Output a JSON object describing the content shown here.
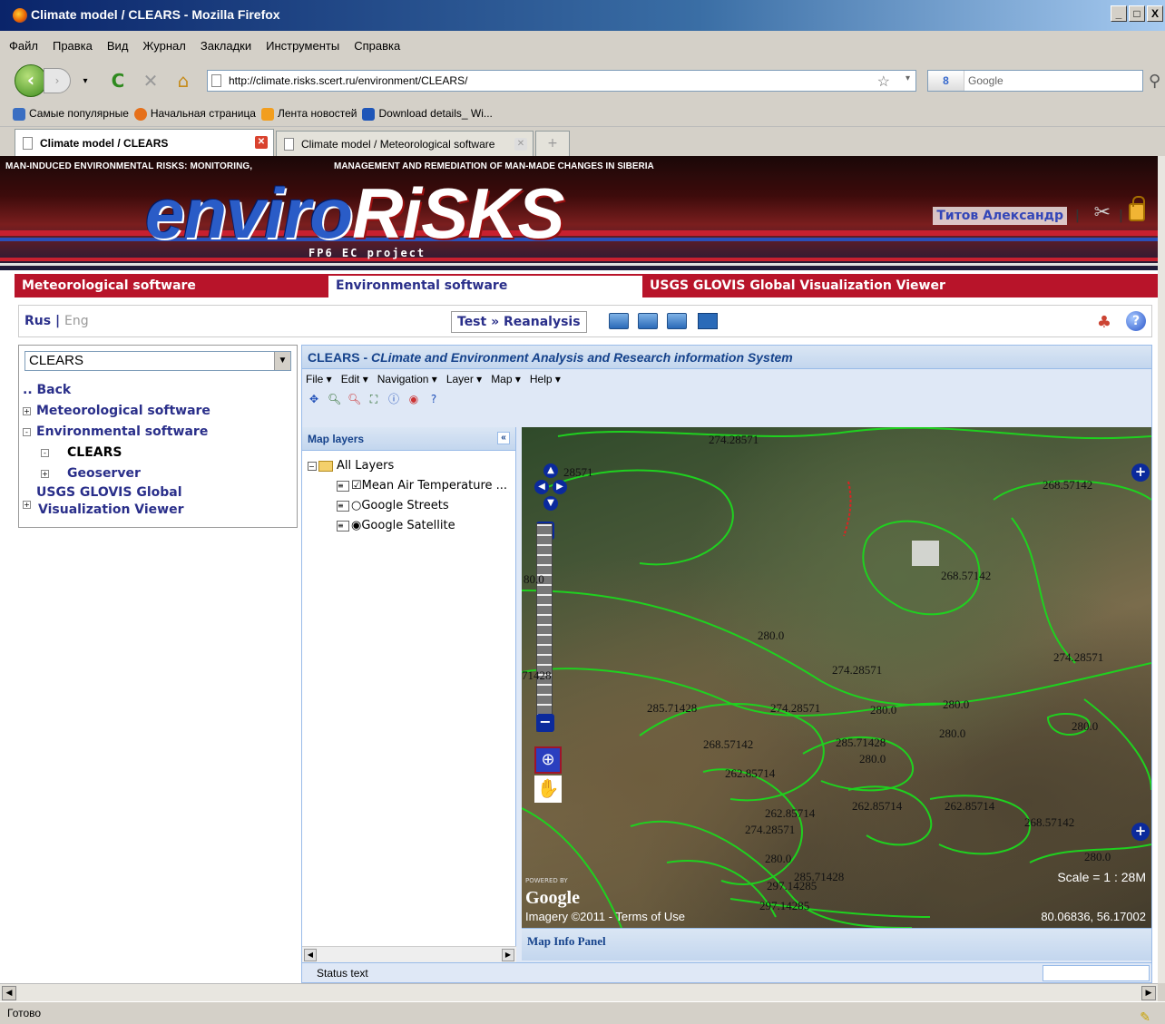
{
  "window": {
    "title": "Climate model / CLEARS - Mozilla Firefox",
    "buttons": [
      "_",
      "□",
      "X"
    ]
  },
  "menu": [
    "Файл",
    "Правка",
    "Вид",
    "Журнал",
    "Закладки",
    "Инструменты",
    "Справка"
  ],
  "nav": {
    "url": "http://climate.risks.scert.ru/environment/CLEARS/",
    "search_placeholder": "Google",
    "engine": "8"
  },
  "bookmarks": [
    {
      "label": "Самые популярные",
      "color": "#3a6ec2"
    },
    {
      "label": "Начальная страница",
      "color": "#e6701a"
    },
    {
      "label": "Лента новостей",
      "color": "#f29e1e"
    },
    {
      "label": "Download details_ Wi...",
      "color": "#1f56b8"
    }
  ],
  "tabs": [
    {
      "label": "Climate model / CLEARS",
      "active": true
    },
    {
      "label": "Climate model / Meteorological software",
      "active": false
    }
  ],
  "banner": {
    "tagline_left": "MAN-INDUCED ENVIRONMENTAL RISKS: MONITORING,",
    "tagline_right": "MANAGEMENT AND REMEDIATION OF MAN-MADE CHANGES IN SIBERIA",
    "logo_part1": "enviro",
    "logo_part2": "RiSKS",
    "subtitle": "FP6 EC project",
    "user": "Титов Александр"
  },
  "topnav": [
    "Meteorological software",
    "Environmental software",
    "USGS GLOVIS Global Visualization Viewer"
  ],
  "lang": {
    "rus": "Rus",
    "sep": "|",
    "eng": "Eng"
  },
  "project": "Test » Reanalysis",
  "sidebar": {
    "select": "CLEARS",
    "items": [
      {
        "label": ".. Back",
        "level": 0,
        "box": ""
      },
      {
        "label": "Meteorological software",
        "level": 0,
        "box": "+"
      },
      {
        "label": "Environmental software",
        "level": 0,
        "box": "-"
      },
      {
        "label": "CLEARS",
        "level": 1,
        "box": "-"
      },
      {
        "label": "Geoserver",
        "level": 1,
        "box": "+"
      },
      {
        "label": "USGS GLOVIS Global",
        "level": 0,
        "box": "+"
      },
      {
        "label": "Visualization Viewer",
        "level": 0,
        "box": ""
      }
    ]
  },
  "app": {
    "title_prefix": "CLEARS - ",
    "title_rest": "CLimate and Environment Analysis and Research information System",
    "menu": [
      "File ▾",
      "Edit ▾",
      "Navigation ▾",
      "Layer ▾",
      "Map ▾",
      "Help ▾"
    ],
    "layers_title": "Map layers",
    "layers": {
      "root": "All Layers",
      "items": [
        {
          "label": "Mean Air Temperature ...",
          "type": "checkbox",
          "checked": true
        },
        {
          "label": "Google Streets",
          "type": "radio",
          "checked": false
        },
        {
          "label": "Google Satellite",
          "type": "radio",
          "checked": true
        }
      ]
    },
    "map": {
      "contour_labels": [
        "274.28571",
        "28571",
        "268.57142",
        "268.57142",
        "80.0",
        "280.0",
        "274.28571",
        "71428",
        "274.28571",
        "285.71428",
        "274.28571",
        "280.0",
        "280.0",
        "280.0",
        "280.0",
        "268.57142",
        "285.71428",
        "280.0",
        "262.85714",
        "262.85714",
        "262.85714",
        "262.85714",
        "274.28571",
        "268.57142",
        "280.0",
        "285.71428",
        "297.14285",
        "280.0",
        "297.14285"
      ],
      "scale": "Scale = 1 : 28M",
      "coords": "80.06836, 56.17002",
      "brand": "Google",
      "powered": "POWERED BY",
      "terms": "Imagery ©2011 - Terms of Use",
      "contour_color": "#1fd11f"
    },
    "info_panel": "Map Info Panel",
    "status": "Status text"
  },
  "statusbar": "Готово"
}
